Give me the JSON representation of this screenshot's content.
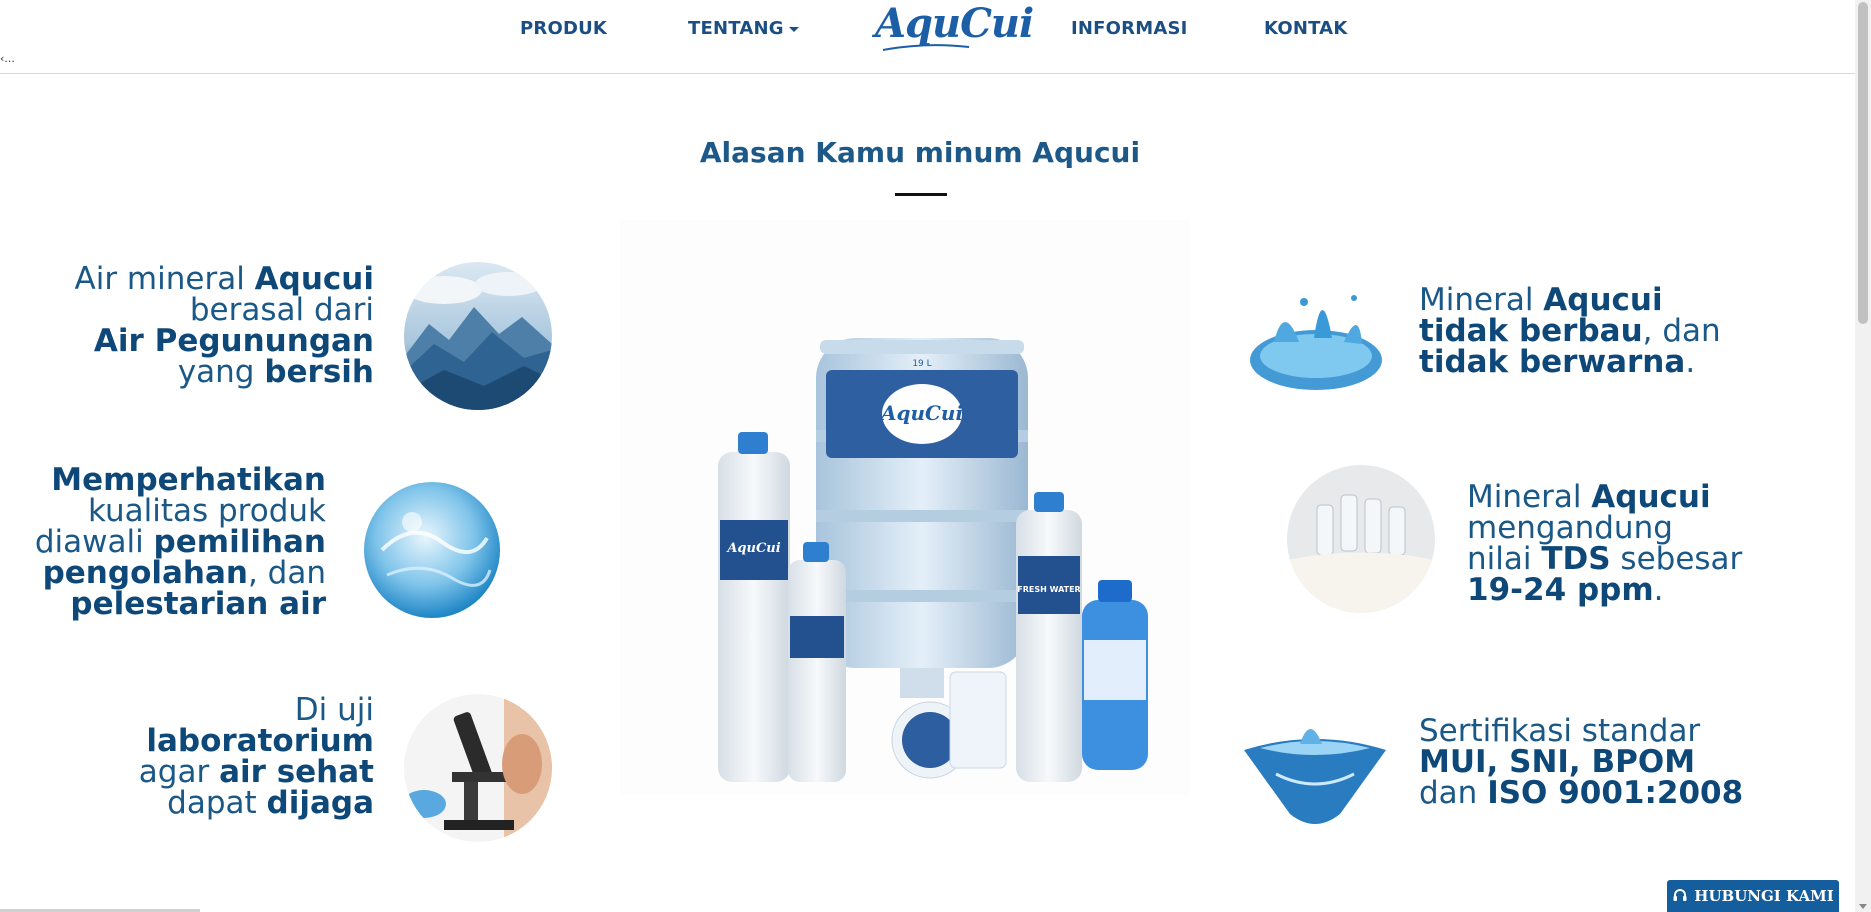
{
  "nav": {
    "produk": "PRODUK",
    "tentang": "TENTANG",
    "logo": "AquCui",
    "informasi": "INFORMASI",
    "kontak": "KONTAK",
    "ellipsis": "‹..."
  },
  "section": {
    "title": "Alasan Kamu minum Aqucui"
  },
  "features_left": [
    {
      "lines": [
        {
          "a": "Air mineral ",
          "b": "Aqucui"
        },
        {
          "a": "berasal dari",
          "b": ""
        },
        {
          "a": "",
          "b": "Air Pegunungan"
        },
        {
          "a": "yang ",
          "b": "bersih"
        }
      ]
    },
    {
      "lines": [
        {
          "a": "",
          "b": "Memperhatikan"
        },
        {
          "a": "kualitas produk",
          "b": ""
        },
        {
          "a": "diawali ",
          "b": "pemilihan"
        },
        {
          "a": "",
          "b": "pengolahan",
          "c": ", dan"
        },
        {
          "a": "",
          "b": "pelestarian air"
        }
      ]
    },
    {
      "lines": [
        {
          "a": "Di uji",
          "b": ""
        },
        {
          "a": "",
          "b": "laboratorium"
        },
        {
          "a": "agar ",
          "b": "air sehat"
        },
        {
          "a": "dapat ",
          "b": "dijaga"
        }
      ]
    }
  ],
  "features_right": [
    {
      "lines": [
        {
          "a": "Mineral ",
          "b": "Aqucui"
        },
        {
          "a": "",
          "b": "tidak berbau",
          "c": ", dan"
        },
        {
          "a": "",
          "b": "tidak berwarna",
          "c": "."
        }
      ]
    },
    {
      "lines": [
        {
          "a": "Mineral ",
          "b": "Aqucui"
        },
        {
          "a": "mengandung",
          "b": ""
        },
        {
          "a": "nilai ",
          "b": "TDS",
          "c": " sebesar"
        },
        {
          "a": "",
          "b": "19-24 ppm",
          "c": "."
        }
      ]
    },
    {
      "lines": [
        {
          "a": "Sertifikasi standar",
          "b": ""
        },
        {
          "a": "",
          "b": "MUI, SNI, BPOM"
        },
        {
          "a": "dan ",
          "b": "ISO 9001:2008"
        }
      ]
    }
  ],
  "product_labels": {
    "gallon_brand": "AquCui",
    "gallon_size": "19 L",
    "bottle_brand": "AquCui",
    "bottle_text": "FRESH WATER"
  },
  "contact_button": {
    "label": "HUBUNGI KAMI",
    "color": "#145e9e"
  },
  "colors": {
    "primary": "#1a5888",
    "accent": "#1c5fa6"
  }
}
